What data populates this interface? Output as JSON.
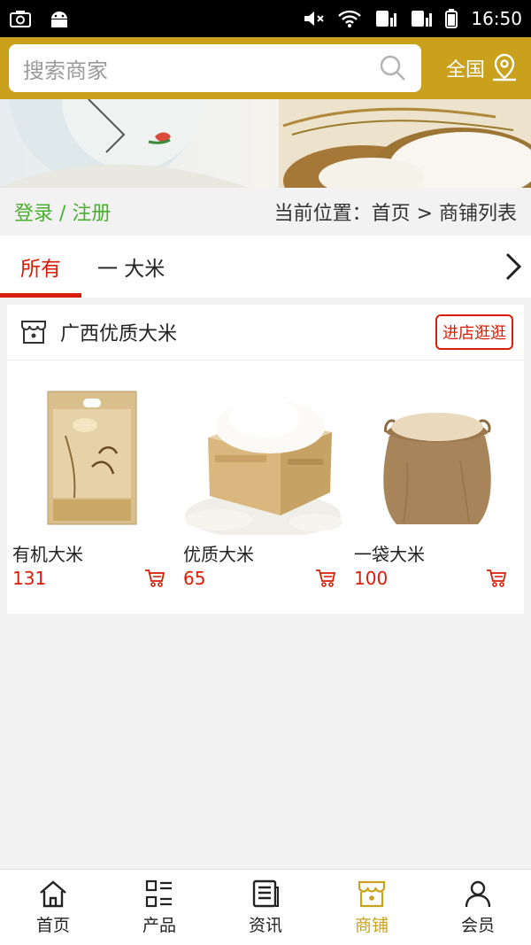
{
  "status_bar": {
    "time": "16:50"
  },
  "search": {
    "placeholder": "搜索商家"
  },
  "region": {
    "label": "全国"
  },
  "nav": {
    "login": "登录 / 注册",
    "breadcrumb": "当前位置：首页 > 商铺列表"
  },
  "tabs": [
    {
      "label": "所有"
    },
    {
      "label": "一 大米"
    }
  ],
  "shop": {
    "name": "广西优质大米",
    "visit_label": "进店逛逛",
    "products": [
      {
        "name": "有机大米",
        "price": "131"
      },
      {
        "name": "优质大米",
        "price": "65"
      },
      {
        "name": "一袋大米",
        "price": "100"
      }
    ]
  },
  "bottom_nav": [
    {
      "label": "首页",
      "icon": "home-icon"
    },
    {
      "label": "产品",
      "icon": "grid-list-icon"
    },
    {
      "label": "资讯",
      "icon": "news-icon"
    },
    {
      "label": "商铺",
      "icon": "store-icon"
    },
    {
      "label": "会员",
      "icon": "user-icon"
    }
  ],
  "colors": {
    "header": "#c9a11d",
    "accent_red": "#d81e06",
    "login_green": "#4cae33",
    "active_nav": "#c9a11d"
  }
}
